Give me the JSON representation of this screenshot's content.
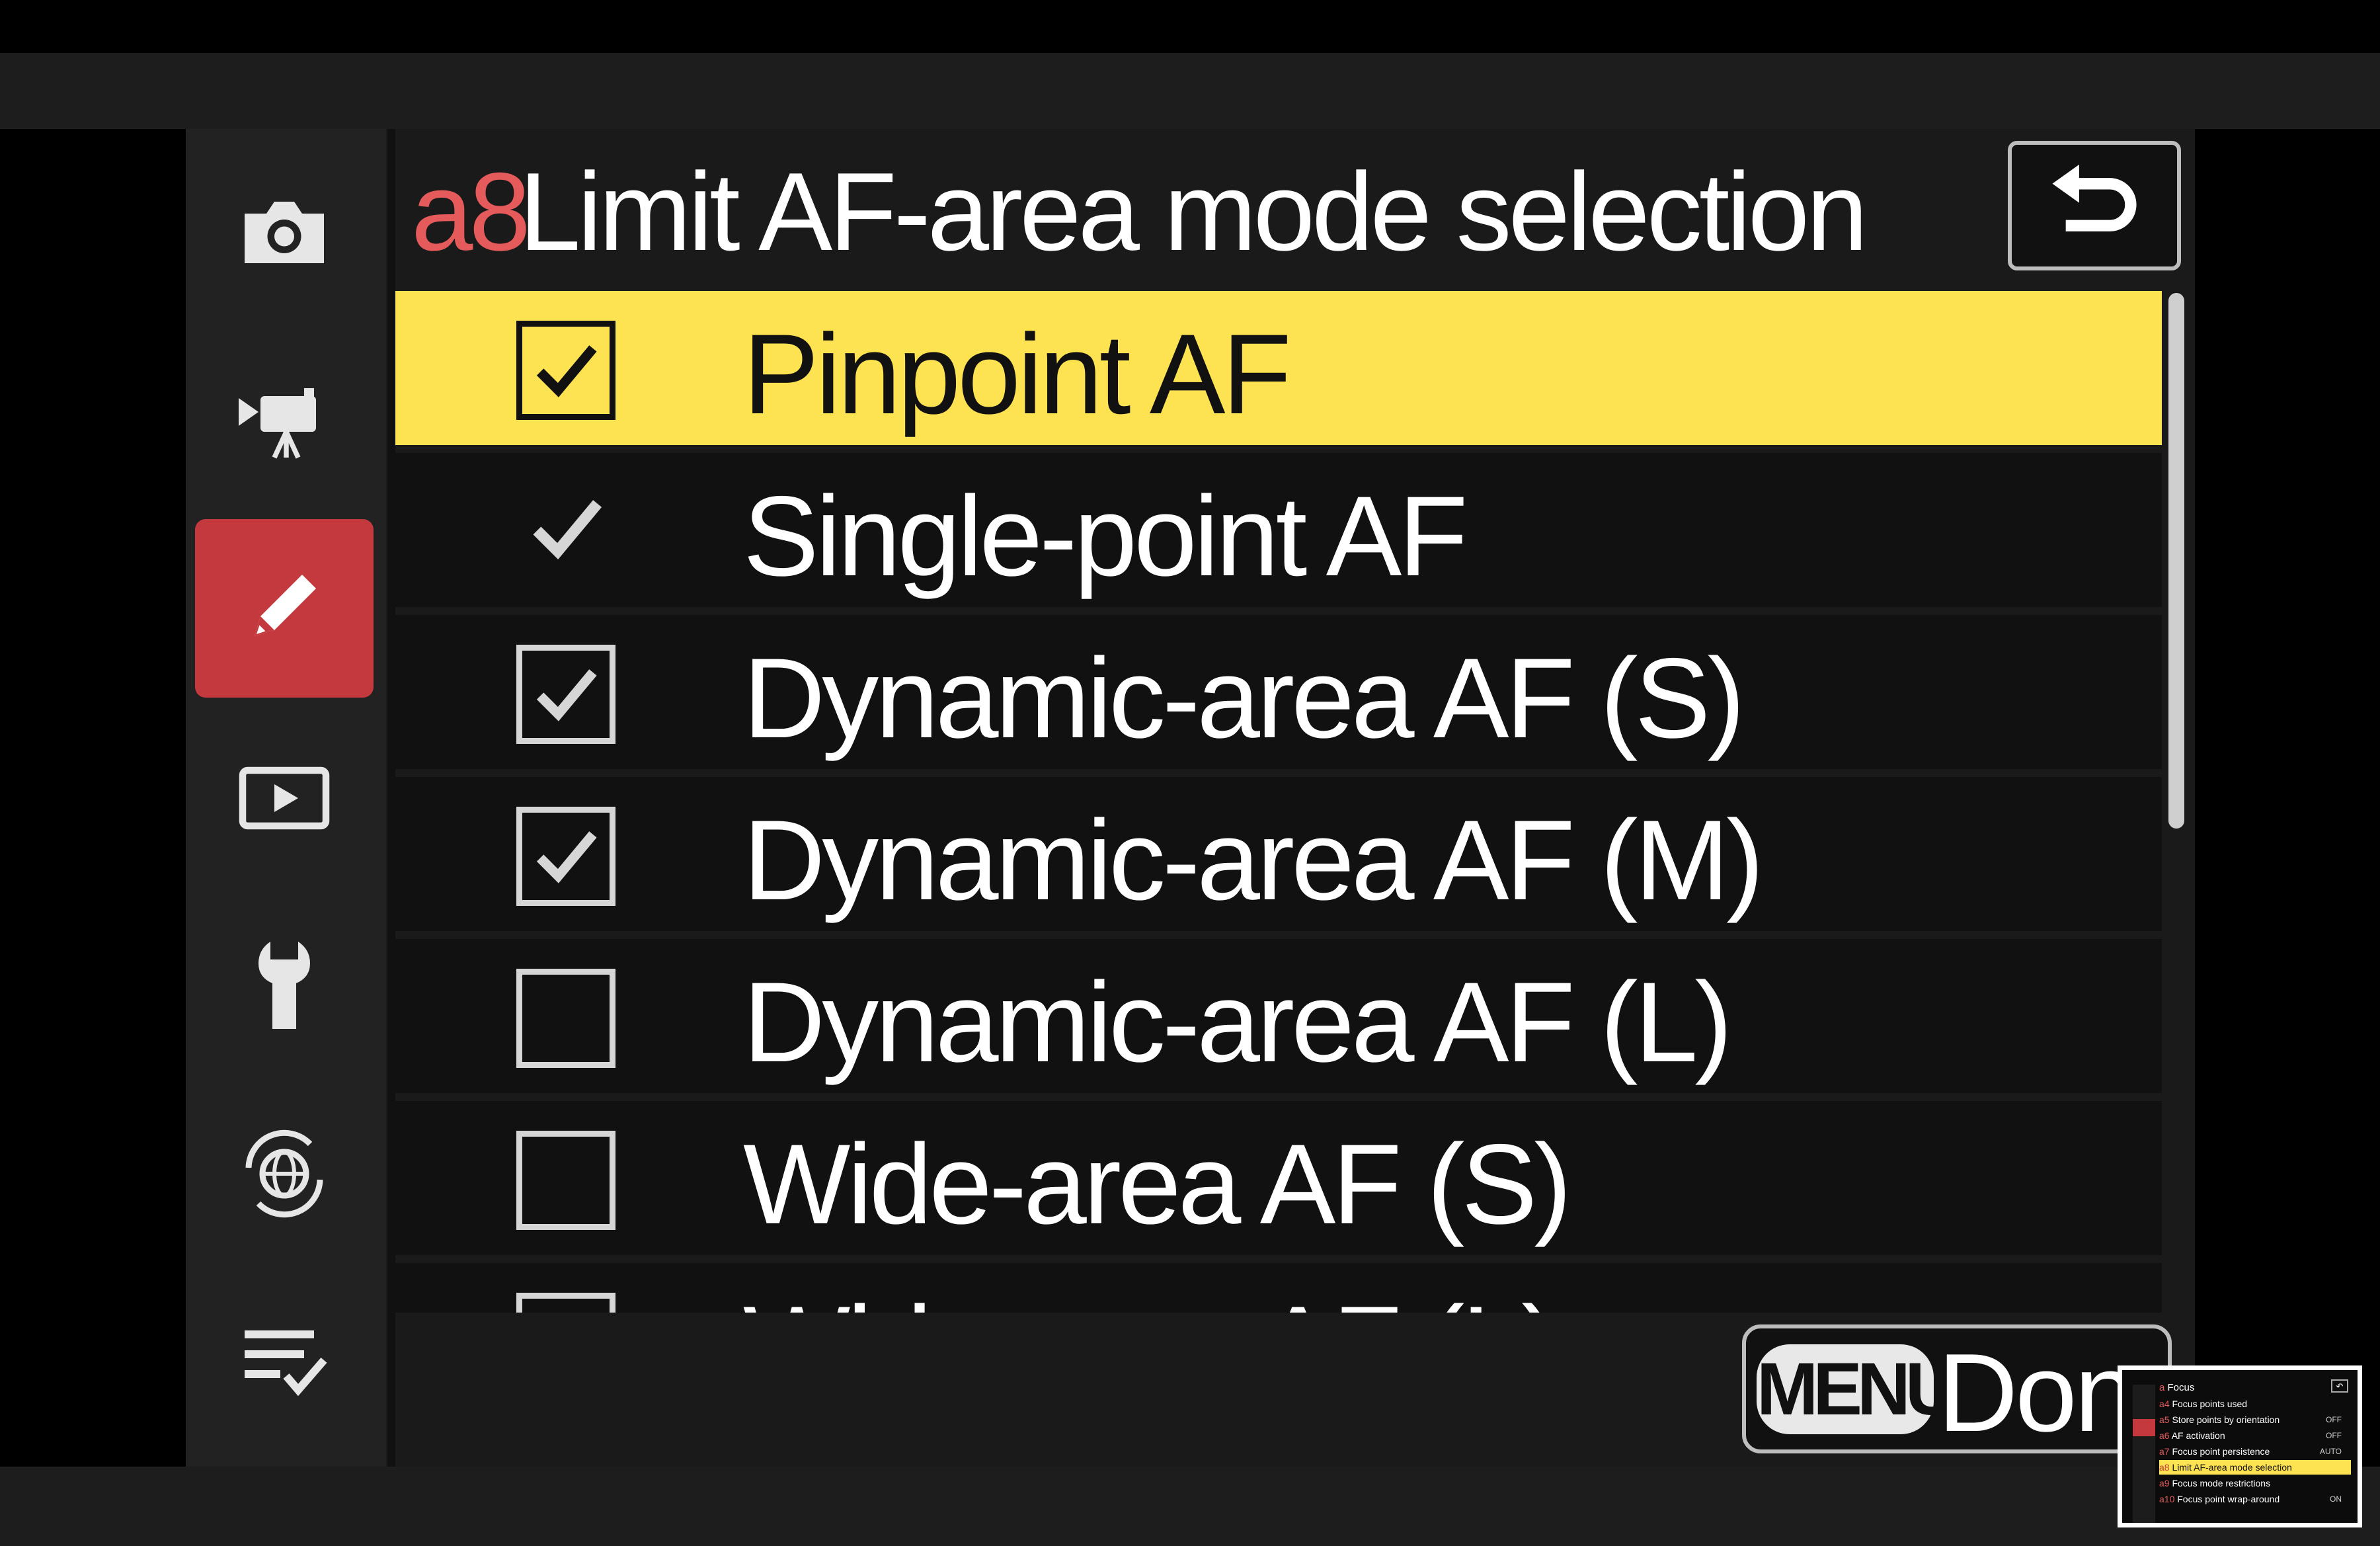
{
  "header": {
    "code": "a8",
    "title": "Limit AF-area mode selection"
  },
  "sidebar": {
    "tabs": [
      {
        "icon": "camera-icon"
      },
      {
        "icon": "movie-camera-icon"
      },
      {
        "icon": "pencil-icon",
        "active": true
      },
      {
        "icon": "playback-icon"
      },
      {
        "icon": "wrench-icon"
      },
      {
        "icon": "network-globe-icon"
      },
      {
        "icon": "my-menu-icon"
      }
    ]
  },
  "list": {
    "items": [
      {
        "label": "Pinpoint AF",
        "state": "checked",
        "selected": true
      },
      {
        "label": "Single-point AF",
        "state": "fixed-check"
      },
      {
        "label": "Dynamic-area AF (S)",
        "state": "checked"
      },
      {
        "label": "Dynamic-area AF (M)",
        "state": "checked"
      },
      {
        "label": "Dynamic-area AF (L)",
        "state": "unchecked"
      },
      {
        "label": "Wide-area AF (S)",
        "state": "unchecked"
      },
      {
        "label": "Wide-area AF (L)",
        "state": "unchecked"
      }
    ]
  },
  "footer": {
    "menu_key": "MENU",
    "done_label": "Done"
  },
  "inset": {
    "header_code": "a",
    "header_title": "Focus",
    "rows": [
      {
        "code": "a4",
        "label": "Focus points used",
        "value": ""
      },
      {
        "code": "a5",
        "label": "Store points by orientation",
        "value": "OFF"
      },
      {
        "code": "a6",
        "label": "AF activation",
        "value": "OFF"
      },
      {
        "code": "a7",
        "label": "Focus point persistence",
        "value": "AUTO"
      },
      {
        "code": "a8",
        "label": "Limit AF-area mode selection",
        "value": "",
        "selected": true
      },
      {
        "code": "a9",
        "label": "Focus mode restrictions",
        "value": ""
      },
      {
        "code": "a10",
        "label": "Focus point wrap-around",
        "value": "ON"
      }
    ]
  },
  "colors": {
    "accent_red": "#c3393d",
    "highlight_yellow": "#fde251",
    "code_red": "#e55a5a"
  }
}
